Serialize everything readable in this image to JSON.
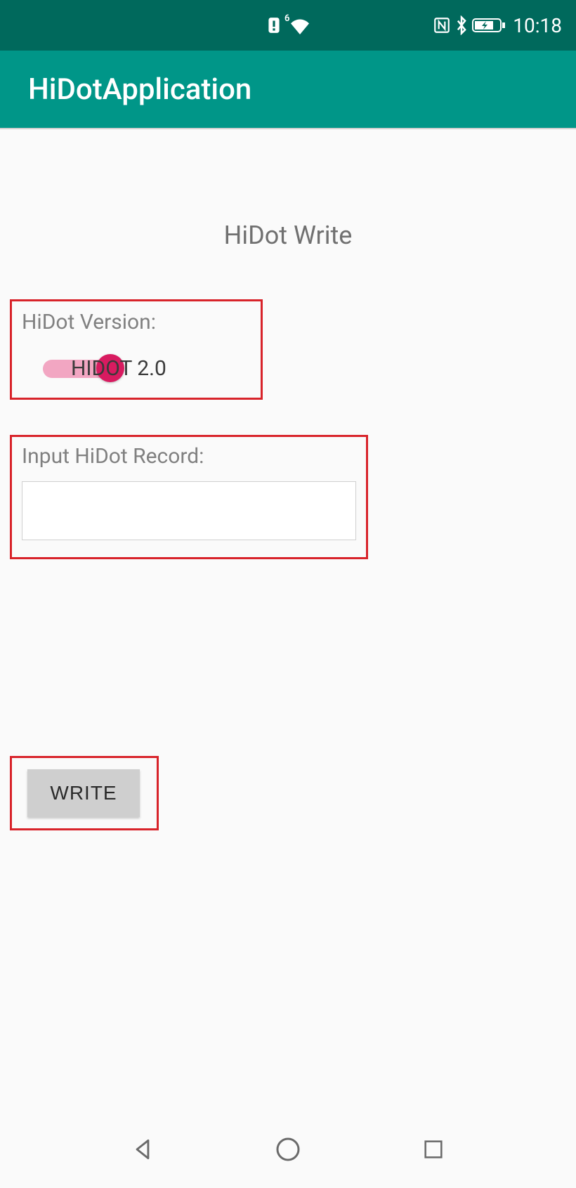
{
  "status": {
    "time": "10:18",
    "wifi_badge": "6"
  },
  "app": {
    "title": "HiDotApplication"
  },
  "page": {
    "title": "HiDot Write"
  },
  "version": {
    "label": "HiDot Version:",
    "value": "HIDOT 2.0"
  },
  "record": {
    "label": "Input HiDot Record:",
    "value": ""
  },
  "buttons": {
    "write": "WRITE"
  }
}
